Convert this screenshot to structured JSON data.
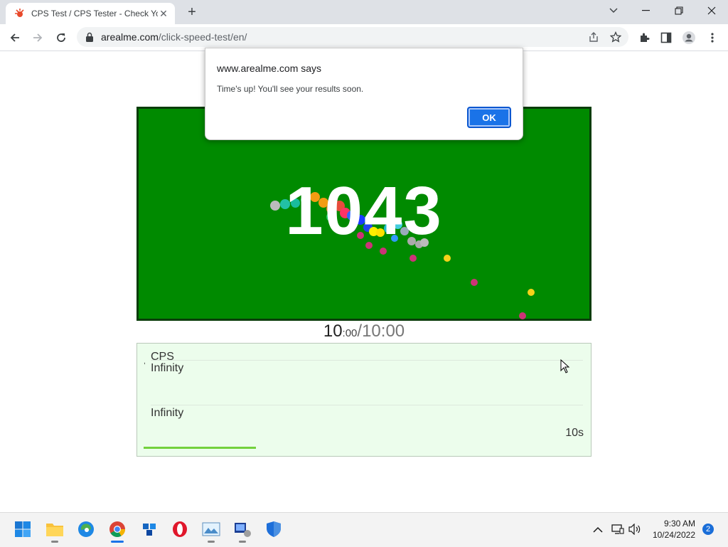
{
  "browser": {
    "tab_title": "CPS Test / CPS Tester - Check Yo",
    "new_tab_symbol": "+",
    "url_host": "arealme.com",
    "url_path": "/click-speed-test/en/",
    "icons": [
      "back-icon",
      "forward-icon",
      "reload-icon",
      "lock-icon",
      "share-icon",
      "star-icon",
      "extensions-icon",
      "sidepanel-icon",
      "profile-icon",
      "menu-icon",
      "tab-search-icon",
      "minimize-icon",
      "restore-icon",
      "close-icon"
    ]
  },
  "dialog": {
    "title": "www.arealme.com says",
    "message": "Time's up! You'll see your results soon.",
    "ok_label": "OK"
  },
  "game": {
    "score": "1043",
    "area_color": "#008a00",
    "timer_current": "10",
    "timer_current_fraction": ":00",
    "timer_separator": "/",
    "timer_total": "10:00"
  },
  "results": {
    "tick": ",",
    "cps_label": "CPS",
    "value1": "Infinity",
    "value2": "Infinity",
    "seconds_label": "10s",
    "progress_fraction": 0.26,
    "bar_color": "#73d13d",
    "panel_color": "#ecfdec"
  },
  "taskbar": {
    "apps": [
      "start-icon",
      "file-explorer-icon",
      "edge-icon",
      "chrome-icon",
      "app-icon",
      "opera-icon",
      "photos-icon",
      "app2-icon",
      "security-icon"
    ],
    "time": "9:30 AM",
    "date": "10/24/2022",
    "notification_count": "2"
  }
}
